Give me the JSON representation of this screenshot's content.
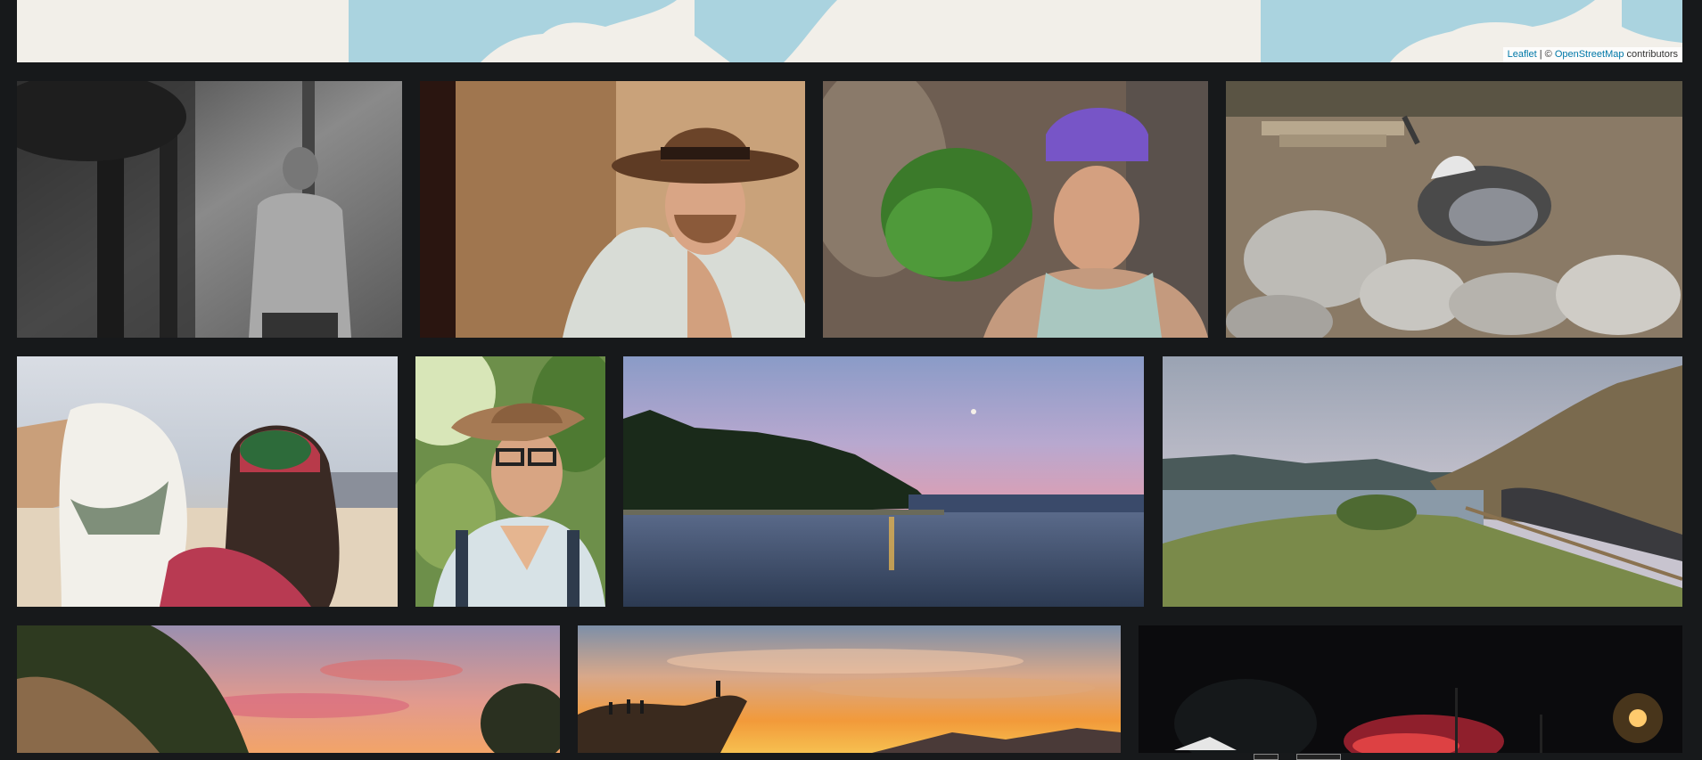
{
  "map": {
    "attribution_leaflet": "Leaflet",
    "attribution_sep": " | © ",
    "attribution_osm": "OpenStreetMap",
    "attribution_tail": " contributors",
    "colors": {
      "land": "#f2efe9",
      "water": "#aad3df"
    }
  },
  "gallery": {
    "photos": [
      {
        "name": "photo-bw-shirtless-man-forest",
        "subject": "black and white shirtless man with glasses in forest"
      },
      {
        "name": "photo-man-brown-fedora",
        "subject": "bearded man in brown fedora, hand on chin"
      },
      {
        "name": "photo-man-purple-bandana",
        "subject": "tattooed man with purple bandana"
      },
      {
        "name": "photo-goat-on-rocks",
        "subject": "goat lying among rocks and branches"
      },
      {
        "name": "photo-person-with-white-dog",
        "subject": "person in red hoodie holding white dog"
      },
      {
        "name": "photo-man-cowboy-hat-glasses",
        "subject": "smiling man in cowboy hat and glasses"
      },
      {
        "name": "photo-lake-sunset-pines",
        "subject": "lake at dusk with pine trees and moon"
      },
      {
        "name": "photo-reservoir-roadside",
        "subject": "reservoir beside mountain road"
      },
      {
        "name": "photo-pink-sunset-cliff",
        "subject": "pink sunset over cliffs"
      },
      {
        "name": "photo-golden-sunset-silhouettes",
        "subject": "silhouettes on rock at golden sunset"
      },
      {
        "name": "photo-night-wildfire",
        "subject": "wildfire glow at night with streetlight"
      }
    ]
  }
}
